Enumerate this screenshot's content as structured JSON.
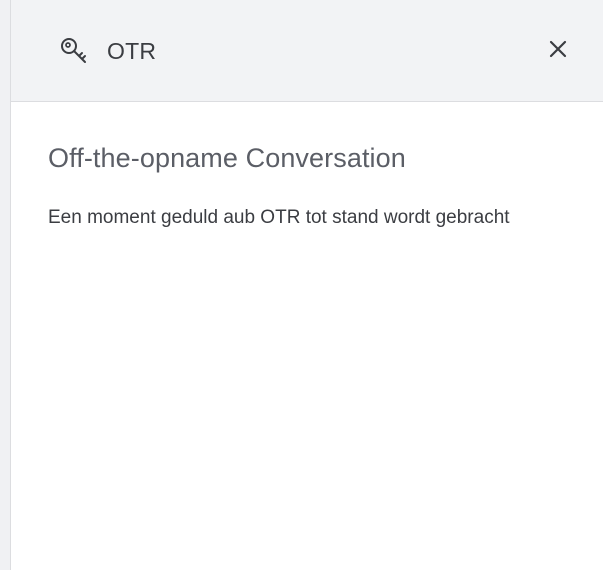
{
  "header": {
    "title": "OTR",
    "icon": "key-icon",
    "close_icon": "close-icon"
  },
  "main": {
    "title": "Off-the-opname Conversation",
    "message": "Een moment geduld aub OTR tot stand wordt gebracht"
  }
}
